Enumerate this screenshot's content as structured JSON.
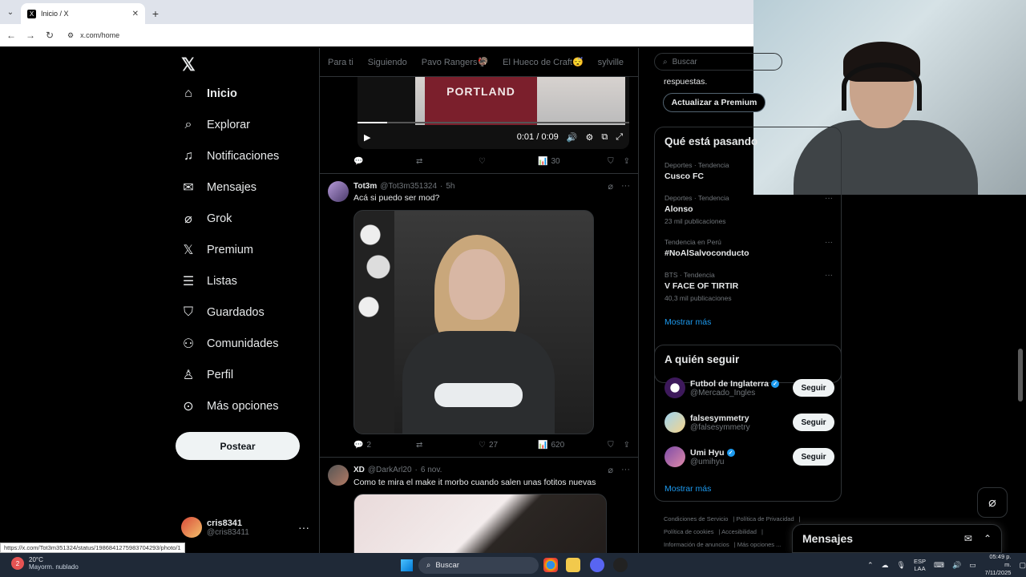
{
  "browser": {
    "tab_title": "Inicio / X",
    "url": "x.com/home",
    "status_url": "https://x.com/Tot3m351324/status/1986841275983704293/photo/1"
  },
  "nav": {
    "items": [
      {
        "label": "Inicio",
        "icon": "home-icon"
      },
      {
        "label": "Explorar",
        "icon": "search-icon"
      },
      {
        "label": "Notificaciones",
        "icon": "bell-icon"
      },
      {
        "label": "Mensajes",
        "icon": "mail-icon"
      },
      {
        "label": "Grok",
        "icon": "grok-icon"
      },
      {
        "label": "Premium",
        "icon": "x-icon"
      },
      {
        "label": "Listas",
        "icon": "list-icon"
      },
      {
        "label": "Guardados",
        "icon": "bookmark-icon"
      },
      {
        "label": "Comunidades",
        "icon": "people-icon"
      },
      {
        "label": "Perfil",
        "icon": "user-icon"
      },
      {
        "label": "Más opciones",
        "icon": "more-circle-icon"
      }
    ],
    "post_label": "Postear",
    "account": {
      "name": "cris8341",
      "handle": "@cris83411"
    }
  },
  "feed": {
    "tabs": [
      "Para ti",
      "Siguiendo",
      "Pavo Rangers🦃",
      "El Hueco de Craft😴",
      "sylville"
    ],
    "video1": {
      "shirt_text": "PORTLAND",
      "time": "0:01 / 0:09",
      "progress": 0.11
    },
    "tweet1_actions": {
      "replies": "",
      "retweets": "",
      "likes": "",
      "views": "30"
    },
    "tweet2": {
      "name": "Tot3m",
      "handle": "@Tot3m351324",
      "time": "5h",
      "text": "Acá si puedo ser mod?",
      "actions": {
        "replies": "2",
        "retweets": "",
        "likes": "27",
        "views": "620"
      }
    },
    "tweet3": {
      "name": "XD",
      "handle": "@DarkArl20",
      "time": "6 nov.",
      "text": "Como te mira el make it morbo cuando salen unas fotitos nuevas"
    }
  },
  "sidebar": {
    "search_placeholder": "Buscar",
    "premium_text": "respuestas.",
    "premium_button": "Actualizar a Premium",
    "trends_title": "Qué está pasando",
    "trends": [
      {
        "meta": "Deportes · Tendencia",
        "title": "Cusco FC",
        "count": ""
      },
      {
        "meta": "Deportes · Tendencia",
        "title": "Alonso",
        "count": "23 mil publicaciones"
      },
      {
        "meta": "Tendencia en Perú",
        "title": "#NoAlSalvoconducto",
        "count": ""
      },
      {
        "meta": "BTS · Tendencia",
        "title": "V FACE OF TIRTIR",
        "count": "40,3 mil publicaciones"
      }
    ],
    "show_more": "Mostrar más",
    "follow_title": "A quién seguir",
    "follow": [
      {
        "name": "Futbol de Inglaterra",
        "handle": "@Mercado_Ingles",
        "verified": true,
        "button": "Seguir"
      },
      {
        "name": "falsesymmetry",
        "handle": "@falsesymmetry",
        "verified": false,
        "button": "Seguir"
      },
      {
        "name": "Umi Hyu",
        "handle": "@umihyu",
        "verified": true,
        "button": "Seguir"
      }
    ],
    "footer": [
      "Condiciones de Servicio",
      "Política de Privacidad",
      "Política de cookies",
      "Accesibilidad",
      "Información de anuncios",
      "Más opciones ..."
    ]
  },
  "messages": {
    "title": "Mensajes"
  },
  "taskbar": {
    "temp": "20°C",
    "weather": "Mayorm. nublado",
    "search": "Buscar",
    "lang_top": "ESP",
    "lang_bottom": "LAA",
    "time": "05:49 p. m.",
    "date": "7/11/2025"
  }
}
